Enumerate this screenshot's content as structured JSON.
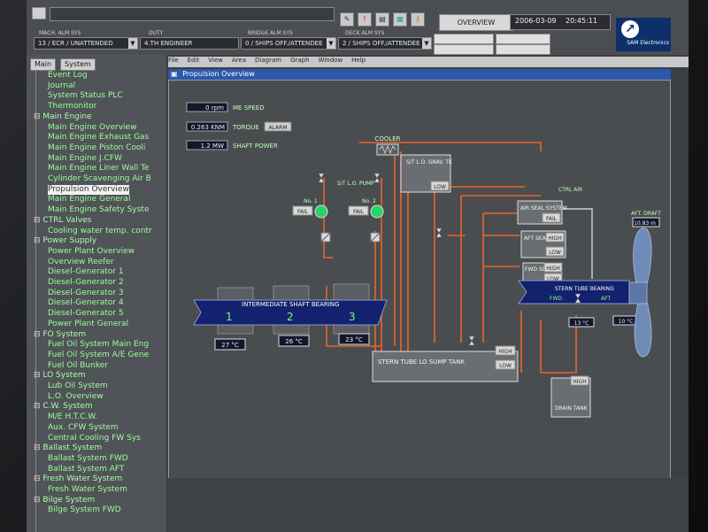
{
  "topbar": {
    "mach_alm": {
      "title": "MACH. ALM SYS",
      "value": "13 / ECR / UNATTENDED"
    },
    "duty": {
      "title": "DUTY",
      "value": "4.TH ENGINEER"
    },
    "bridge_alm": {
      "title": "BRIDGE ALM SYS",
      "value": "0 / SHIPS OFF./ATTENDEE"
    },
    "deck_alm": {
      "title": "DECK ALM SYS",
      "value": "2 / SHIPS OFF./ATTENDEE"
    },
    "overview_label": "OVERVIEW",
    "date": "2006-03-09",
    "time": "20:45:11",
    "logo_text": "SAM Electronics"
  },
  "left_tabs": [
    "Main",
    "System"
  ],
  "tree": [
    {
      "label": "Event Log",
      "indent": 2
    },
    {
      "label": "Journal",
      "indent": 2
    },
    {
      "label": "System Status PLC",
      "indent": 2
    },
    {
      "label": "Thermonitor",
      "indent": 2
    },
    {
      "label": "Main Engine",
      "indent": 1,
      "parent": true
    },
    {
      "label": "Main Engine Overview",
      "indent": 2
    },
    {
      "label": "Main Engine Exhaust Gas",
      "indent": 2
    },
    {
      "label": "Main Engine Piston Cooli",
      "indent": 2
    },
    {
      "label": "Main Engine J.CFW",
      "indent": 2
    },
    {
      "label": "Main Engine Liner Wall Te",
      "indent": 2
    },
    {
      "label": "Cylinder Scavenging Air B",
      "indent": 2
    },
    {
      "label": "Propulsion Overview",
      "indent": 2,
      "selected": true
    },
    {
      "label": "Main Engine General",
      "indent": 2
    },
    {
      "label": "Main Engine Safety Syste",
      "indent": 2
    },
    {
      "label": "CTRL Valves",
      "indent": 1,
      "parent": true
    },
    {
      "label": "Cooling water temp. contr",
      "indent": 2
    },
    {
      "label": "Power Supply",
      "indent": 1,
      "parent": true
    },
    {
      "label": "Power Plant Overview",
      "indent": 2
    },
    {
      "label": "Overview Reefer",
      "indent": 2
    },
    {
      "label": "Diesel-Generator 1",
      "indent": 2
    },
    {
      "label": "Diesel-Generator 2",
      "indent": 2
    },
    {
      "label": "Diesel-Generator 3",
      "indent": 2
    },
    {
      "label": "Diesel-Generator 4",
      "indent": 2
    },
    {
      "label": "Diesel-Generator 5",
      "indent": 2
    },
    {
      "label": "Power Plant General",
      "indent": 2
    },
    {
      "label": "FO System",
      "indent": 1,
      "parent": true
    },
    {
      "label": "Fuel Oil System Main Eng",
      "indent": 2
    },
    {
      "label": "Fuel Oil System A/E Gene",
      "indent": 2
    },
    {
      "label": "Fuel Oil Bunker",
      "indent": 2
    },
    {
      "label": "LO System",
      "indent": 1,
      "parent": true
    },
    {
      "label": "Lub Oil System",
      "indent": 2
    },
    {
      "label": "L.O. Overview",
      "indent": 2
    },
    {
      "label": "C.W. System",
      "indent": 1,
      "parent": true
    },
    {
      "label": "M/E H.T.C.W.",
      "indent": 2
    },
    {
      "label": "Aux. CFW System",
      "indent": 2
    },
    {
      "label": "Central Cooling FW Sys",
      "indent": 2
    },
    {
      "label": "Ballast System",
      "indent": 1,
      "parent": true
    },
    {
      "label": "Ballast System FWD",
      "indent": 2
    },
    {
      "label": "Ballast System AFT",
      "indent": 2
    },
    {
      "label": "Fresh Water System",
      "indent": 1,
      "parent": true
    },
    {
      "label": "Fresh Water System",
      "indent": 2
    },
    {
      "label": "Bilge System",
      "indent": 1,
      "parent": true
    },
    {
      "label": "Bilge System FWD",
      "indent": 2
    }
  ],
  "menu": [
    "File",
    "Edit",
    "View",
    "Area",
    "Diagram",
    "Graph",
    "Window",
    "Help"
  ],
  "window_title": "Propulsion Overview",
  "readouts": [
    {
      "value": "0 rpm",
      "label": "ME SPEED"
    },
    {
      "value": "0.263 KNM",
      "label": "TORQUE",
      "alarm": "ALARM"
    },
    {
      "value": "1.2 MW",
      "label": "SHAFT POWER"
    }
  ],
  "diagram": {
    "cooler": "COOLER",
    "grav_tank": {
      "label": "S/T L.O. GRAV. TK",
      "status": "LOW"
    },
    "pump_title": "S/T L.O. PUMP",
    "pump1": {
      "name": "No. 1",
      "status": "FAIL"
    },
    "pump2": {
      "name": "No. 2",
      "status": "FAIL"
    },
    "ctrl_air": "CTRL AIR",
    "air_seal": {
      "label": "AIR SEAL SYSTEM",
      "status": "FAIL"
    },
    "aft_seal": {
      "label": "AFT SEAL TK",
      "high": "HIGH",
      "low": "LOW"
    },
    "fwd_seal": {
      "label": "FWD SEAL TK",
      "high": "HIGH",
      "low": "LOW"
    },
    "aft_draft": {
      "label": "AFT. DRAFT",
      "value": "10.83 m"
    },
    "shaft_bearing": {
      "label": "INTERMEDIATE SHAFT BEARING",
      "numbers": [
        "1",
        "2",
        "3"
      ],
      "temps": [
        "27 °C",
        "26 °C",
        "23 °C"
      ]
    },
    "stern_bearing": {
      "label": "STERN TUBE BEARING",
      "fwd": "FWD",
      "aft": "AFT",
      "temps": [
        "13 °C",
        "10 °C"
      ]
    },
    "sump_tank": {
      "label": "STERN TUBE LO SUMP TANK",
      "high": "HIGH",
      "low": "LOW"
    },
    "drain_tank": {
      "label": "DRAIN TANK",
      "high": "HIGH"
    }
  }
}
